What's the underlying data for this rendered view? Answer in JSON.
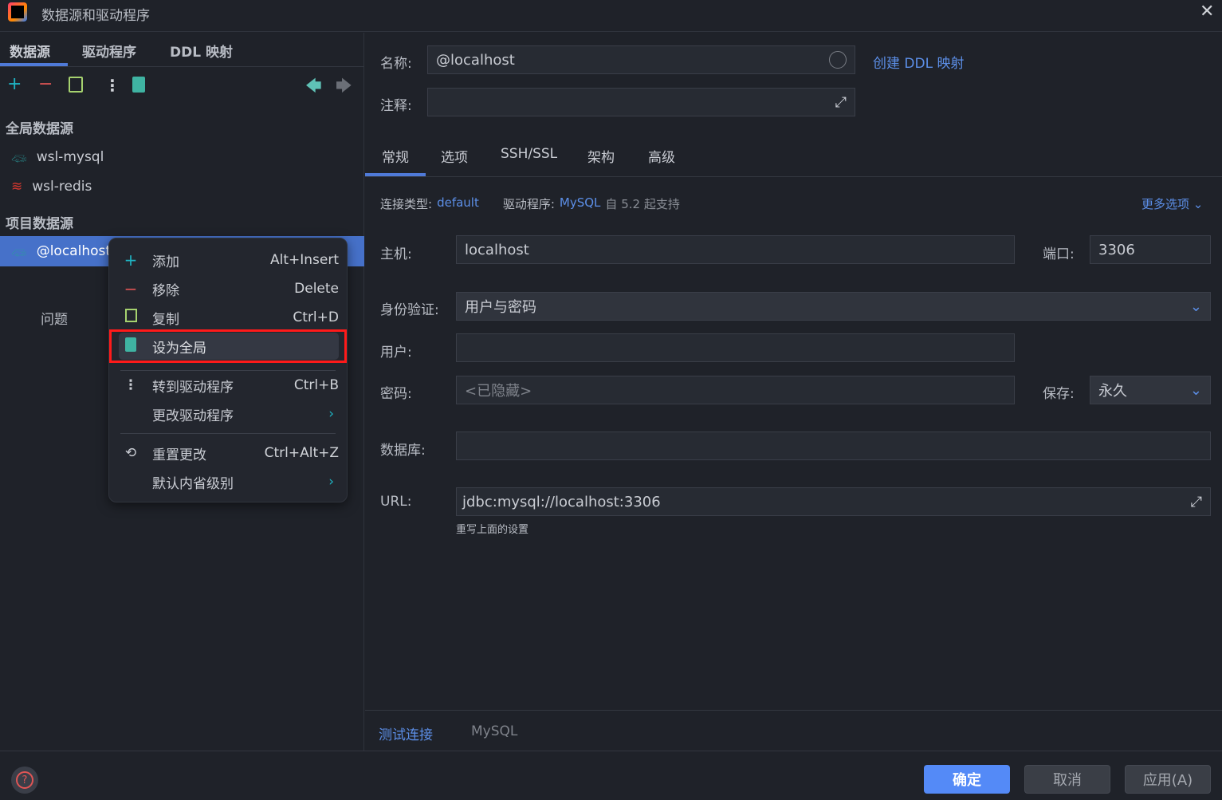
{
  "window": {
    "title": "数据源和驱动程序",
    "close_icon": "close-icon"
  },
  "left": {
    "tabs": [
      "数据源",
      "驱动程序",
      "DDL 映射"
    ],
    "toolbar": {
      "add": "+",
      "remove": "−",
      "back": "🡄",
      "forward": "🡆"
    },
    "global_header": "全局数据源",
    "global_items": [
      "wsl-mysql",
      "wsl-redis"
    ],
    "project_header": "项目数据源",
    "project_items": [
      "@localhost"
    ],
    "problems": "问题"
  },
  "context_menu": {
    "items": [
      {
        "label": "添加",
        "shortcut": "Alt+Insert"
      },
      {
        "label": "移除",
        "shortcut": "Delete"
      },
      {
        "label": "复制",
        "shortcut": "Ctrl+D"
      },
      {
        "label": "设为全局",
        "shortcut": ""
      },
      {
        "label": "转到驱动程序",
        "shortcut": "Ctrl+B"
      },
      {
        "label": "更改驱动程序",
        "shortcut": "›"
      },
      {
        "label": "重置更改",
        "shortcut": "Ctrl+Alt+Z"
      },
      {
        "label": "默认内省级别",
        "shortcut": "›"
      }
    ],
    "highlight_color": "#ff1a1a"
  },
  "form": {
    "name_label": "名称:",
    "name_value": "@localhost",
    "create_ddl": "创建 DDL 映射",
    "comment_label": "注释:",
    "comment_value": "",
    "tabs": [
      "常规",
      "选项",
      "SSH/SSL",
      "架构",
      "高级"
    ],
    "conn_type_label": "连接类型:",
    "conn_type": "default",
    "driver_label": "驱动程序:",
    "driver": "MySQL",
    "driver_note": "自 5.2 起支持",
    "more_options": "更多选项",
    "host_label": "主机:",
    "host": "localhost",
    "port_label": "端口:",
    "port": "3306",
    "auth_label": "身份验证:",
    "auth": "用户与密码",
    "user_label": "用户:",
    "user": "",
    "password_label": "密码:",
    "password": "<已隐藏>",
    "save_label": "保存:",
    "save": "永久",
    "database_label": "数据库:",
    "database": "",
    "url_label": "URL:",
    "url": "jdbc:mysql://localhost:3306",
    "url_note": "重写上面的设置",
    "test_connection": "测试连接",
    "driver_footer": "MySQL"
  },
  "footer": {
    "help": "?",
    "ok": "确定",
    "cancel": "取消",
    "apply": "应用(A)"
  },
  "colors": {
    "accent": "#4f7ad8",
    "primary_button": "#548af7",
    "selection": "#4671c9"
  }
}
